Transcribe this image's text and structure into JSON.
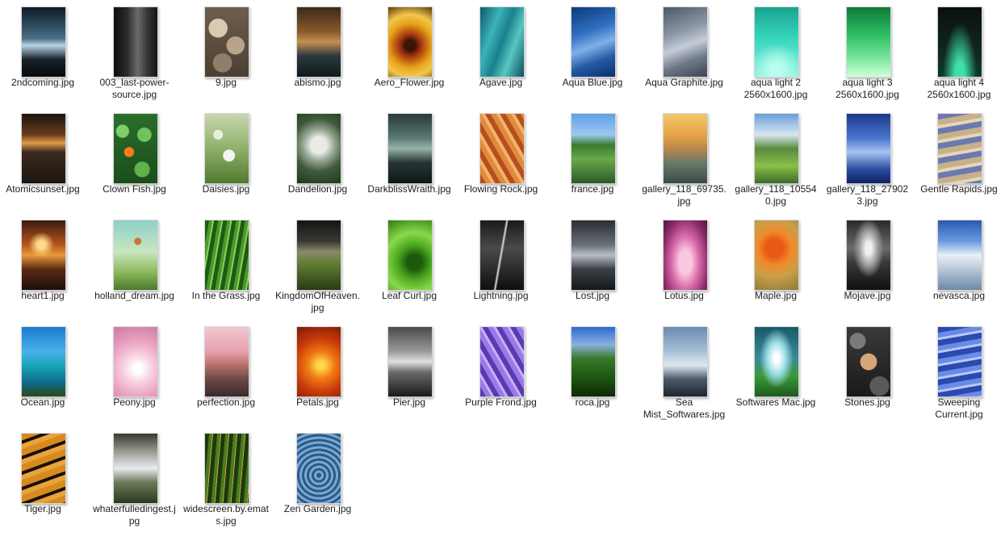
{
  "files": [
    {
      "name": "2ndcoming.jpg",
      "bg": "linear-gradient(180deg,#0c1a26 0%,#4a6f86 45%,#b8d4e6 55%,#18232b 75%,#07090b 100%)"
    },
    {
      "name": "003_last-power-source.jpg",
      "bg": "linear-gradient(90deg,#0d0d0d 0%,#2a2a2a 30%,#6b6b6b 55%,#3a3a3a 75%,#141414 100%)"
    },
    {
      "name": "9.jpg",
      "bg": "radial-gradient(circle at 30% 30%,#d9cbb0 0 16%,transparent 17%),radial-gradient(circle at 70% 55%,#b8a48a 0 18%,transparent 19%),radial-gradient(circle at 40% 80%,#8f7e6a 0 15%,transparent 16%),linear-gradient(#6e5f4e,#4a3f33)"
    },
    {
      "name": "abismo.jpg",
      "bg": "linear-gradient(180deg,#3b2a1a 0%,#8a5a2a 35%,#c49050 50%,#2b3a3e 70%,#10181b 100%)"
    },
    {
      "name": "Aero_Flower.jpg",
      "bg": "radial-gradient(circle at 50% 55%,#3a1506 0 12%,#a5350f 25%,#e6a21a 50%,#f2c84a 70%,#5a3a0a 100%)"
    },
    {
      "name": "Agave.jpg",
      "bg": "linear-gradient(110deg,#0f5a6e 0%,#3bb3b8 30%,#1b7f8e 50%,#57c7c2 70%,#0d4d5e 100%)"
    },
    {
      "name": "Aqua Blue.jpg",
      "bg": "linear-gradient(160deg,#0a3a7a 0%,#2f6fc0 35%,#7fb0e6 55%,#245aa6 75%,#0b2f66 100%)"
    },
    {
      "name": "Aqua Graphite.jpg",
      "bg": "linear-gradient(160deg,#4d5866 0%,#8a96a6 35%,#c5ccd6 55%,#6d7888 75%,#3d4552 100%)"
    },
    {
      "name": "aqua light 2 2560x1600.jpg",
      "bg": "radial-gradient(circle at 50% 90%,#b8fff0 0 8%,transparent 40%),linear-gradient(180deg,#1aa391 0%,#37d6bd 45%,#8af0dd 100%)"
    },
    {
      "name": "aqua light 3 2560x1600.jpg",
      "bg": "linear-gradient(180deg,#0f7a38 0%,#2fbf63 40%,#7de8a0 75%,#cfffd9 100%)"
    },
    {
      "name": "aqua light 4 2560x1600.jpg",
      "bg": "radial-gradient(ellipse at 50% 100%,#3fe0a8 0 15%,transparent 55%),linear-gradient(180deg,#0a0f0e 0%,#10261f 60%,#0b3a2c 100%)"
    },
    {
      "name": "Atomicsunset.jpg",
      "bg": "linear-gradient(180deg,#1a1410 0%,#6a3c1c 30%,#e09a4a 42%,#3a2a1e 55%,#1c1612 100%)"
    },
    {
      "name": "Clown Fish.jpg",
      "bg": "radial-gradient(circle at 35% 55%,#ff7a1a 0 10%,transparent 11%),radial-gradient(circle at 20% 25%,#7ed06a 0 10%,transparent 11%),radial-gradient(circle at 70% 30%,#6fc25c 0 12%,transparent 13%),radial-gradient(circle at 65% 80%,#5fb24c 0 12%,transparent 13%),linear-gradient(#2a6e2a,#1b4d1b)"
    },
    {
      "name": "Daisies.jpg",
      "bg": "radial-gradient(circle at 55% 60%,#f5f5f0 0 12%,transparent 13%),radial-gradient(circle at 30% 30%,#e8eee0 0 8%,transparent 9%),linear-gradient(180deg,#c8d6b0 0%,#8fb06a 50%,#4f7a2e 100%)"
    },
    {
      "name": "Dandelion.jpg",
      "bg": "radial-gradient(circle at 50% 45%,#e8ece4 0 18%,#9aa896 35%,#3f5a3a 60%,#1f3a1e 100%)"
    },
    {
      "name": "DarkblissWraith.jpg",
      "bg": "linear-gradient(180deg,#2a3a38 0%,#5a7a74 35%,#98b2aa 50%,#263634 70%,#101818 100%)"
    },
    {
      "name": "Flowing Rock.jpg",
      "bg": "repeating-linear-gradient(60deg,#b84e1e 0 6px,#e08a3e 6px 12px,#f2b36a 12px 16px)"
    },
    {
      "name": "france.jpg",
      "bg": "linear-gradient(180deg,#5fa0e6 0%,#9cc8f0 30%,#3a7a2e 45%,#6aa84a 65%,#2a5a2a 100%)"
    },
    {
      "name": "gallery_118_69735.jpg",
      "bg": "linear-gradient(180deg,#f0c86a 0%,#e8a448 30%,#b8884a 50%,#6a7a6a 70%,#3a4a4a 100%)"
    },
    {
      "name": "gallery_118_105540.jpg",
      "bg": "linear-gradient(180deg,#6aa0d8 0%,#d8e6f0 30%,#5a8a3e 50%,#8ac04a 75%,#3a6a2a 100%)"
    },
    {
      "name": "gallery_118_279023.jpg",
      "bg": "linear-gradient(180deg,#1a3a8a 0%,#4a74d0 35%,#a8c4f0 55%,#2a4aa0 80%,#0f2460 100%)"
    },
    {
      "name": "Gentle Rapids.jpg",
      "bg": "repeating-linear-gradient(170deg,#6a7ab0 0 7px,#c8b08a 7px 14px,#e8d6b8 14px 18px)"
    },
    {
      "name": "heart1.jpg",
      "bg": "radial-gradient(circle at 45% 35%,#ffd88a 0 8%,transparent 25%),linear-gradient(180deg,#3a1a10 0%,#b8541e 35%,#e89a3a 50%,#5a2a14 70%,#1e0e08 100%)"
    },
    {
      "name": "holland_dream.jpg",
      "bg": "radial-gradient(circle at 55% 30%,#c87a2a 0 6%,transparent 7%),linear-gradient(180deg,#8fd0c8 0%,#c8e6c0 45%,#8ab85a 75%,#4a7a2a 100%)"
    },
    {
      "name": "In the Grass.jpg",
      "bg": "repeating-linear-gradient(100deg,#1e5a14 0 5px,#4a9a2a 5px 9px,#8ad05a 9px 11px)"
    },
    {
      "name": "KingdomOfHeaven.jpg",
      "bg": "linear-gradient(180deg,#141414 0%,#3a3a34 30%,#8a8a6a 45%,#5a7a2e 65%,#2a3a14 100%)"
    },
    {
      "name": "Leaf Curl.jpg",
      "bg": "radial-gradient(circle at 60% 60%,#1e5a0e 0 15%,#4aa81e 35%,#8ad84a 60%,#2e7a14 100%)"
    },
    {
      "name": "Lightning.jpg",
      "bg": "linear-gradient(100deg,transparent 45%,#e0e0e0 48%,transparent 51%),linear-gradient(180deg,#1a1a1a 0%,#4a4a4a 40%,#0e0e0e 100%)"
    },
    {
      "name": "Lost.jpg",
      "bg": "linear-gradient(180deg,#2a2e32 0%,#6a7078 35%,#b8bec4 50%,#3a4046 70%,#14181c 100%)"
    },
    {
      "name": "Lotus.jpg",
      "bg": "radial-gradient(ellipse at 50% 60%,#f8c8e0 0 20%,#d86aa8 45%,#8a2a6a 75%,#4a1a3a 100%)"
    },
    {
      "name": "Maple.jpg",
      "bg": "radial-gradient(circle at 45% 40%,#e85a14 0 18%,#f08a2a 35%,#c8a04a 60%,#8a7a3a 100%)"
    },
    {
      "name": "Mojave.jpg",
      "bg": "radial-gradient(ellipse at 50% 40%,#f0f0f0 0 10%,#9a9a9a 30%,transparent 50%),linear-gradient(180deg,#2a2a2a 0%,#6a6a6a 40%,#3a3a3a 60%,#101010 100%)"
    },
    {
      "name": "nevasca.jpg",
      "bg": "linear-gradient(180deg,#2a5ab0 0%,#6a9ae0 30%,#e8f0f8 50%,#b8c8d8 70%,#6a8aa8 100%)"
    },
    {
      "name": "Ocean.jpg",
      "bg": "linear-gradient(180deg,#1a7ad0 0%,#4ab0e8 35%,#1aa8b8 55%,#0e6a8a 80%,#2a4a1a 100%)"
    },
    {
      "name": "Peony.jpg",
      "bg": "radial-gradient(circle at 55% 60%,#ffffff 0 8%,#f8d0e0 30%,#e8a0c0 60%,#c87aa0 100%)"
    },
    {
      "name": "perfection.jpg",
      "bg": "linear-gradient(180deg,#f0c8d0 0%,#e8a0b0 35%,#b8706a 55%,#6a4a48 75%,#3a2a2a 100%)"
    },
    {
      "name": "Petals.jpg",
      "bg": "radial-gradient(circle at 55% 55%,#ffd84a 0 8%,#f07a14 30%,#c83a0a 60%,#7a1a06 100%)"
    },
    {
      "name": "Pier.jpg",
      "bg": "linear-gradient(180deg,#4a4a4a 0%,#9a9a9a 35%,#e0e0e0 50%,#6a6a6a 65%,#1a1a1a 100%)"
    },
    {
      "name": "Purple Frond.jpg",
      "bg": "repeating-linear-gradient(60deg,#5a3ab0 0 6px,#9a7ae6 6px 12px,#c8b0f8 12px 15px)"
    },
    {
      "name": "roca.jpg",
      "bg": "linear-gradient(180deg,#2a6ad0 0%,#8ab0e0 25%,#3a7a2a 45%,#1e5a14 70%,#0e2a08 100%)"
    },
    {
      "name": "Sea Mist_Softwares.jpg",
      "bg": "linear-gradient(180deg,#6a8ab0 0%,#a8c0d8 35%,#e0e8f0 55%,#4a5a6a 75%,#1e262e 100%)"
    },
    {
      "name": "Softwares Mac.jpg",
      "bg": "radial-gradient(ellipse at 50% 45%,#ffffff 0 8%,#9adce6 30%,transparent 55%),linear-gradient(180deg,#1a5a6a 0%,#3a8a9a 45%,#3a9a3a 70%,#1e5a1e 100%)"
    },
    {
      "name": "Stones.jpg",
      "bg": "radial-gradient(circle at 50% 50%,#d8a47a 0 20%,transparent 21%),radial-gradient(circle at 25% 20%,#7a7a7a 0 12%,transparent 13%),radial-gradient(circle at 75% 85%,#5a5a5a 0 14%,transparent 15%),linear-gradient(#3a3a3a,#1a1a1a)"
    },
    {
      "name": "Sweeping Current.jpg",
      "bg": "repeating-linear-gradient(170deg,#2a4ab0 0 7px,#6a8ae6 7px 13px,#b8c8f8 13px 16px)"
    },
    {
      "name": "Tiger.jpg",
      "bg": "repeating-linear-gradient(160deg,#d88a1e 0 8px,#1a1006 8px 12px,#e8a43a 12px 18px)"
    },
    {
      "name": "whaterfulledingest.jpg",
      "bg": "linear-gradient(180deg,#3a3a2e 0%,#a8aaa0 30%,#e8ecf0 50%,#6a7a5a 70%,#2a3a1e 100%)"
    },
    {
      "name": "widescreen.by.emats.jpg",
      "bg": "repeating-linear-gradient(95deg,#1a3a0e 0 5px,#4a7a1e 5px 9px,#c8a43a 9px 10px)"
    },
    {
      "name": "Zen Garden.jpg",
      "bg": "repeating-radial-gradient(circle at 50% 60%,#2a5a8a 0 3px,#7aa8d0 3px 6px)"
    }
  ]
}
